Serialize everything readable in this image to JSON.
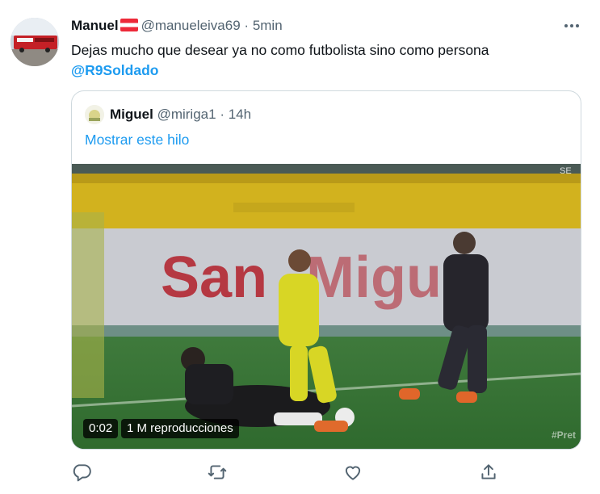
{
  "tweet": {
    "author_name": "Manuel",
    "handle": "@manueleiva69",
    "separator": "·",
    "time": "5min",
    "text": "Dejas mucho que desear ya no como futbolista sino como persona",
    "mention": "@R9Soldado"
  },
  "quoted": {
    "author_name": "Miguel",
    "handle": "@miriga1",
    "separator": "·",
    "time": "14h",
    "show_thread": "Mostrar este hilo",
    "video": {
      "duration": "0:02",
      "views": "1 M reproducciones",
      "watermark": "#Pret",
      "corner_text": "SE"
    }
  },
  "icons": {
    "more": "more-horizontal-icon",
    "reply": "reply-icon",
    "retweet": "retweet-icon",
    "like": "heart-icon",
    "share": "share-icon"
  },
  "colors": {
    "link": "#1d9bf0",
    "muted": "#536471",
    "text": "#0f1419",
    "border": "#cfd9de"
  }
}
